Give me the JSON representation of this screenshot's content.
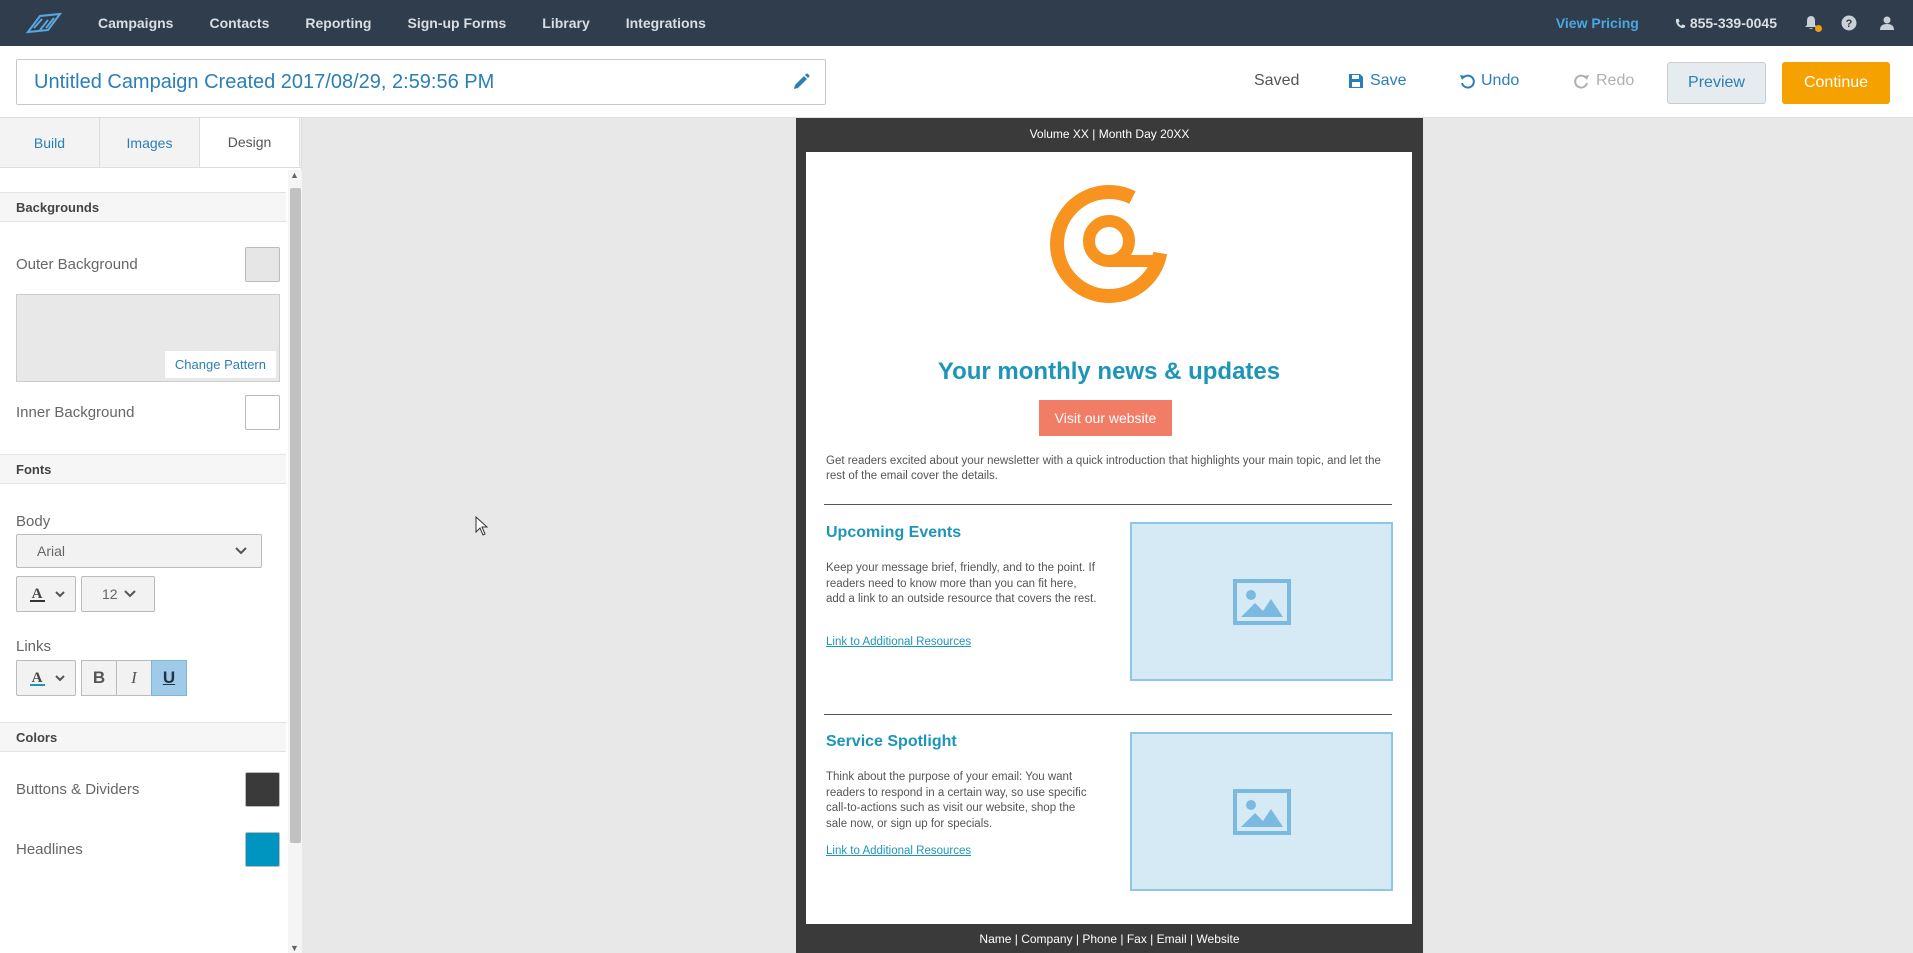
{
  "nav": {
    "links": [
      "Campaigns",
      "Contacts",
      "Reporting",
      "Sign-up Forms",
      "Library",
      "Integrations"
    ],
    "view_pricing": "View Pricing",
    "phone": "855-339-0045"
  },
  "header": {
    "campaign_title": "Untitled Campaign Created 2017/08/29, 2:59:56 PM",
    "status": "Saved",
    "save_label": "Save",
    "undo_label": "Undo",
    "redo_label": "Redo",
    "preview_label": "Preview",
    "continue_label": "Continue"
  },
  "sidebar": {
    "tabs": [
      "Build",
      "Images",
      "Design"
    ],
    "active_tab": "Design",
    "backgrounds": {
      "heading": "Backgrounds",
      "outer_label": "Outer Background",
      "outer_color": "#e6e6e6",
      "change_pattern": "Change Pattern",
      "inner_label": "Inner Background",
      "inner_color": "#ffffff"
    },
    "fonts": {
      "heading": "Fonts",
      "body_label": "Body",
      "body_font": "Arial",
      "body_size": "12",
      "links_label": "Links",
      "bold": "B",
      "italic": "I",
      "underline": "U"
    },
    "colors": {
      "heading": "Colors",
      "buttons_label": "Buttons & Dividers",
      "buttons_color": "#3a3a3a",
      "headlines_label": "Headlines",
      "headlines_color": "#0094c0"
    }
  },
  "email": {
    "volume_line": "Volume XX | Month Day 20XX",
    "headline": "Your monthly news & updates",
    "cta": "Visit our website",
    "intro": "Get readers excited about your newsletter with a quick introduction that highlights your main topic, and let the rest of the email cover the details.",
    "sections": [
      {
        "heading": "Upcoming Events",
        "body": "Keep your message brief, friendly, and to the point. If readers need to know more than you can fit here, add a link to an outside resource that covers the rest.",
        "link": "Link to Additional Resources"
      },
      {
        "heading": "Service Spotlight",
        "body": "Think about the purpose of your email: You want readers to respond in a certain way, so use specific call-to-actions such as visit our website, shop the sale now, or sign up for specials.",
        "link": "Link to Additional Resources"
      }
    ],
    "footer": "Name | Company | Phone | Fax | Email | Website",
    "accent_color": "#f7931e"
  }
}
